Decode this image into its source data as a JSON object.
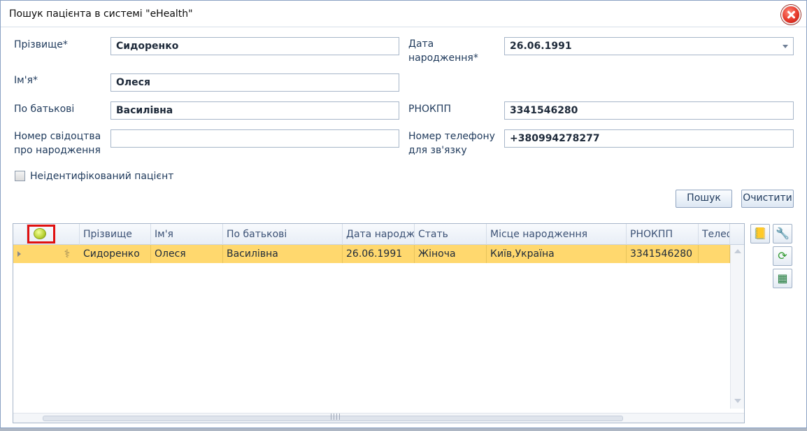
{
  "window": {
    "title": "Пошук пацієнта в системі \"eHealth\""
  },
  "form": {
    "surname_label": "Прізвище*",
    "surname_value": "Сидоренко",
    "name_label": "Ім'я*",
    "name_value": "Олеся",
    "patronymic_label": "По батькові",
    "patronymic_value": "Василівна",
    "birth_cert_label_1": "Номер свідоцтва",
    "birth_cert_label_2": "про народження",
    "birth_cert_value": "",
    "birth_date_label_1": "Дата",
    "birth_date_label_2": "народження*",
    "birth_date_value": "26.06.1991",
    "rnokpp_label": "РНОКПП",
    "rnokpp_value": "3341546280",
    "phone_label_1": "Номер телефону",
    "phone_label_2": "для зв'язку",
    "phone_value": "+380994278277",
    "unidentified_label": "Неідентифікований пацієнт",
    "search_button": "Пошук",
    "clear_button": "Очистити"
  },
  "grid": {
    "columns": [
      "Прізвище",
      "Ім'я",
      "По батькові",
      "Дата народж",
      "Стать",
      "Місце народження",
      "РНОКПП",
      "Телеф"
    ],
    "rows": [
      {
        "surname": "Сидоренко",
        "name": "Олеся",
        "patronymic": "Василівна",
        "birth_date": "26.06.1991",
        "sex": "Жіноча",
        "birthplace": "Київ,Україна",
        "rnokpp": "3341546280",
        "phone": ""
      }
    ],
    "hscroll_grip": "||||"
  },
  "icons": {
    "close": "close-icon",
    "status": "status-green-icon",
    "medical": "caduceus-icon",
    "tools": [
      "book-icon",
      "wrench-icon",
      "refresh-icon",
      "excel-icon"
    ]
  },
  "colors": {
    "selected_row": "#ffd86e",
    "highlight": "#e01010",
    "accent": "#1e395b"
  }
}
